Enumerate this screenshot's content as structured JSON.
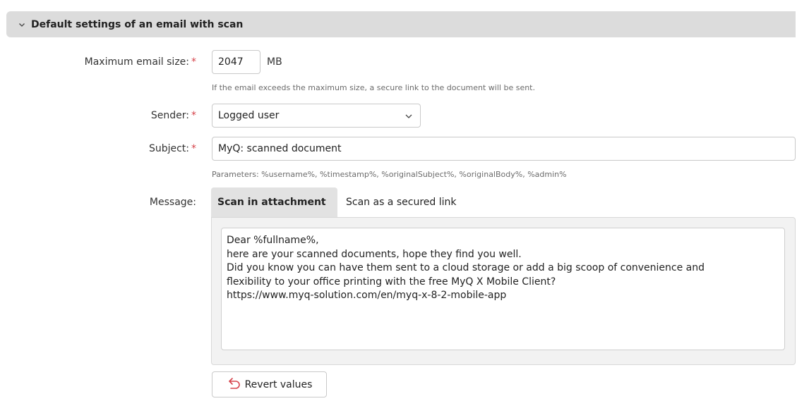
{
  "section": {
    "title": "Default settings of an email with scan",
    "icon": "chevron-down-icon"
  },
  "fields": {
    "max_size": {
      "label": "Maximum email size:",
      "required_marker": "*",
      "value": "2047",
      "unit": "MB",
      "hint": "If the email exceeds the maximum size, a secure link to the document will be sent."
    },
    "sender": {
      "label": "Sender:",
      "required_marker": "*",
      "value": "Logged user"
    },
    "subject": {
      "label": "Subject:",
      "required_marker": "*",
      "value": "MyQ: scanned document",
      "hint": "Parameters: %username%, %timestamp%, %originalSubject%, %originalBody%, %admin%"
    },
    "message": {
      "label": "Message:",
      "tabs": [
        {
          "label": "Scan in attachment",
          "active": true
        },
        {
          "label": "Scan as a secured link",
          "active": false
        }
      ],
      "lines": [
        "Dear %fullname%,",
        "",
        "here are your scanned documents, hope they find you well.",
        "Did you know you can have them sent to a cloud storage or add a big scoop of convenience and",
        "flexibility to your office printing with the free MyQ X Mobile Client?",
        "",
        "https://www.myq-solution.com/en/myq-x-8-2-mobile-app"
      ]
    }
  },
  "revert": {
    "label": "Revert values",
    "icon": "undo-arrow-icon",
    "icon_color": "#d6434b"
  },
  "colors": {
    "header_bg": "#dcdcdc",
    "required": "#d6434b",
    "tab_active_bg": "#e2e2e2"
  }
}
